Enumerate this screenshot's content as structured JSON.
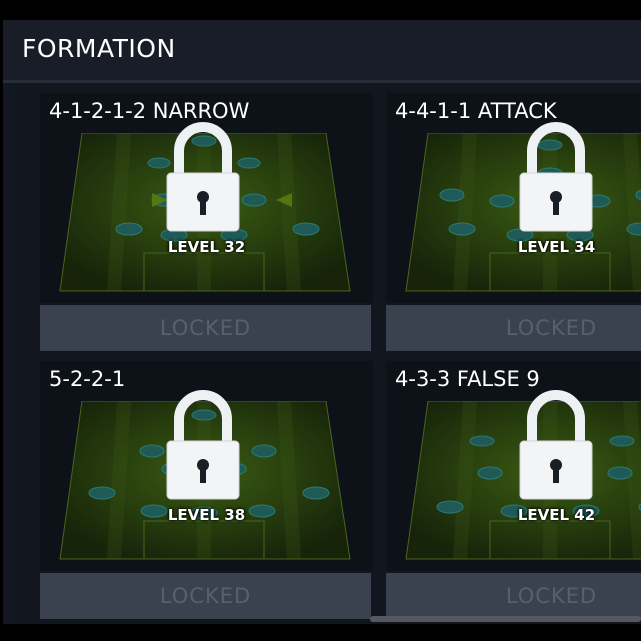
{
  "header": {
    "title": "FORMATION"
  },
  "formations": [
    {
      "name": "4-1-2-1-2 NARROW",
      "level": "LEVEL 32",
      "status": "LOCKED"
    },
    {
      "name": "4-4-1-1 ATTACK",
      "level": "LEVEL 34",
      "status": "LOCKED"
    },
    {
      "name": "5-2-2-1",
      "level": "LEVEL 38",
      "status": "LOCKED"
    },
    {
      "name": "4-3-3 FALSE 9",
      "level": "LEVEL 42",
      "status": "LOCKED"
    }
  ],
  "colors": {
    "accent_lock": "#ffffff",
    "pitch": "#2f4a10",
    "locked_button": "#3a4250"
  }
}
